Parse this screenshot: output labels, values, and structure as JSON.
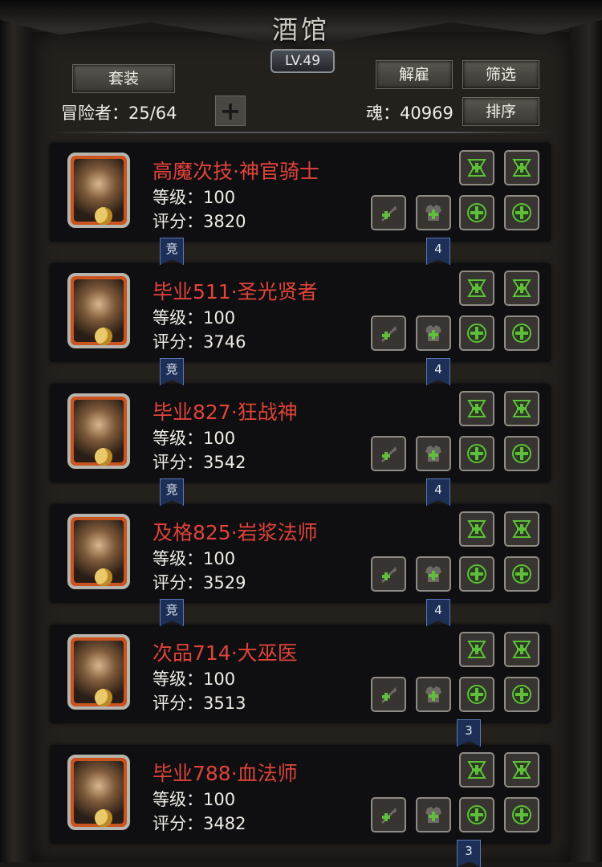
{
  "header": {
    "title": "酒馆",
    "level": "LV.49"
  },
  "toolbar": {
    "set_label": "套装",
    "dismiss_label": "解雇",
    "filter_label": "筛选",
    "sort_label": "排序",
    "adventurers_text": "冒险者：25/64",
    "soul_text": "魂：40969"
  },
  "heroes": [
    {
      "name": "高魔次技·神官骑士",
      "level": "等级：100",
      "score": "评分：3820",
      "tag_left": "竞",
      "tag_right": "4"
    },
    {
      "name": "毕业511·圣光贤者",
      "level": "等级：100",
      "score": "评分：3746",
      "tag_left": "竞",
      "tag_right": "4"
    },
    {
      "name": "毕业827·狂战神",
      "level": "等级：100",
      "score": "评分：3542",
      "tag_left": "竞",
      "tag_right": "4"
    },
    {
      "name": "及格825·岩浆法师",
      "level": "等级：100",
      "score": "评分：3529",
      "tag_left": "竞",
      "tag_right": "4"
    },
    {
      "name": "次品714·大巫医",
      "level": "等级：100",
      "score": "评分：3513",
      "tag_left": "",
      "tag_right": "3"
    },
    {
      "name": "毕业788·血法师",
      "level": "等级：100",
      "score": "评分：3482",
      "tag_left": "",
      "tag_right": "3"
    }
  ],
  "colors": {
    "name_red": "#e0433a",
    "accent_green": "#5fbf3a",
    "tag_blue": "#1d2f56"
  }
}
